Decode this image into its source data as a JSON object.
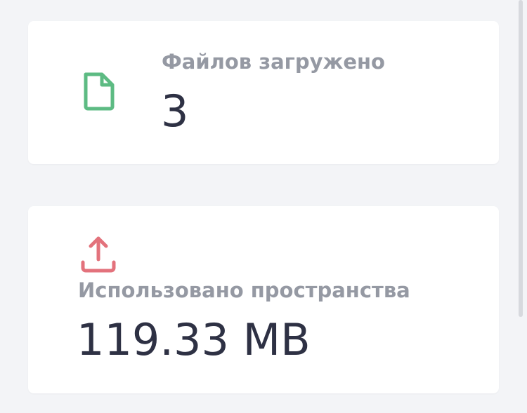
{
  "stats": {
    "files_uploaded": {
      "label": "Файлов загружено",
      "value": "3",
      "icon": "file-icon",
      "icon_color": "#5dbb83"
    },
    "space_used": {
      "label": "Использовано пространства",
      "value": "119.33 MB",
      "icon": "upload-icon",
      "icon_color": "#e3727c"
    }
  },
  "colors": {
    "background": "#f3f4f7",
    "card": "#ffffff",
    "label": "#9599a3",
    "value": "#2e3144"
  }
}
